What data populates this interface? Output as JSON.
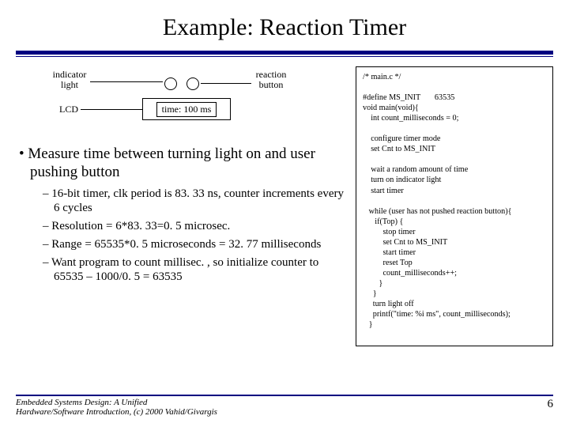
{
  "title": "Example: Reaction Timer",
  "diagram": {
    "indicator_label": "indicator light",
    "lcd_label": "LCD",
    "reaction_label": "reaction button",
    "lcd_text": "time: 100 ms"
  },
  "bullets": {
    "main": "• Measure time between turning light on and user pushing button",
    "sub1": "– 16-bit timer, clk period is 83. 33 ns, counter increments every 6 cycles",
    "sub2": "– Resolution = 6*83. 33=0. 5 microsec.",
    "sub3": "– Range = 65535*0. 5 microseconds = 32. 77 milliseconds",
    "sub4": "– Want program to count millisec. , so initialize counter to 65535 – 1000/0. 5 = 63535"
  },
  "code": "/* main.c */\n\n#define MS_INIT       63535\nvoid main(void){\n    int count_milliseconds = 0;\n\n    configure timer mode\n    set Cnt to MS_INIT\n\n    wait a random amount of time\n    turn on indicator light\n    start timer\n\n   while (user has not pushed reaction button){\n      if(Top) {\n          stop timer\n          set Cnt to MS_INIT\n          start timer\n          reset Top\n          count_milliseconds++;\n        }\n     }\n     turn light off\n     printf(\"time: %i ms\", count_milliseconds);\n   }",
  "footer": {
    "credit": "Embedded Systems Design: A Unified\nHardware/Software Introduction, (c) 2000 Vahid/Givargis",
    "page": "6"
  }
}
